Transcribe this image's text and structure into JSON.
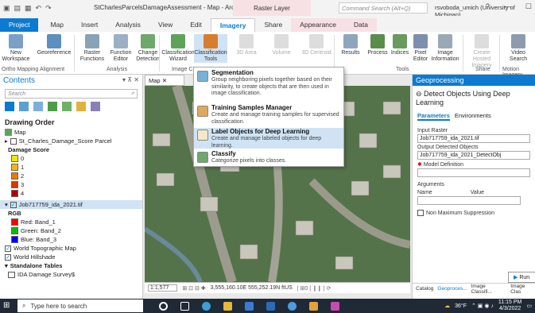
{
  "titlebar": {
    "title": "StCharlesParcelsDamageAssessment - Map - ArcGIS Pro",
    "context": "Raster Layer",
    "command_search": "Command Search (Alt+Q)",
    "user": "rsvoboda_umich (University of Michigan)",
    "help": "?",
    "minimize": "—",
    "maximize": "☐"
  },
  "tabs": [
    "Project",
    "Map",
    "Insert",
    "Analysis",
    "View",
    "Edit",
    "Imagery",
    "Share",
    "Appearance",
    "Data"
  ],
  "ribbon": {
    "buttons": [
      "New Workspace",
      "Georeference",
      "Raster Functions",
      "Function Editor",
      "Change Detection",
      "Classification Wizard",
      "Classification Tools",
      "3D Area",
      "Volume",
      "3D Centroid",
      "Results",
      "Process",
      "Indices",
      "Pixel Editor",
      "Image Information",
      "Create Hosted Imagery",
      "Video Search"
    ],
    "groups": [
      "Ortho Mapping",
      "Alignment",
      "Analysis",
      "Image Cla",
      "Tools",
      "Share",
      "Motion Imagery"
    ]
  },
  "contents": {
    "title": "Contents",
    "search_placeholder": "Search",
    "drawing_order": "Drawing Order",
    "map": "Map",
    "layer_parcel": "St_Charles_Damage_Score Parcel",
    "damage_score": "Damage Score",
    "legend": [
      {
        "label": "0",
        "color": "#f0e800"
      },
      {
        "label": "1",
        "color": "#f5b700"
      },
      {
        "label": "2",
        "color": "#e87a00"
      },
      {
        "label": "3",
        "color": "#d43a00"
      },
      {
        "label": "4",
        "color": "#b00000"
      }
    ],
    "raster_layer": "Job717759_ida_2021.tif",
    "rgb": "RGB",
    "bands": [
      {
        "label": "Red:  Band_1",
        "color": "#ff0000"
      },
      {
        "label": "Green:  Band_2",
        "color": "#00c000"
      },
      {
        "label": "Blue:  Band_3",
        "color": "#0000ff"
      }
    ],
    "basemap_topo": "World Topographic Map",
    "basemap_hillshade": "World Hillshade",
    "standalone": "Standalone Tables",
    "table": "IDA Damage Survey$"
  },
  "map": {
    "tab": "Map",
    "scale": "1:1,577",
    "coords": "3,555,160.10E 555,252.19N ftUS",
    "tools": "| ⊞0 | ❙❙ | ⟳"
  },
  "menu": [
    {
      "title": "Segmentation",
      "desc": "Group neighboring pixels together based on their similarity, to create objects that are then used in image classification."
    },
    {
      "title": "Training Samples Manager",
      "desc": "Create and manage training samples for supervised classification."
    },
    {
      "title": "Label Objects for Deep Learning",
      "desc": "Create and manage labeled objects for deep learning."
    },
    {
      "title": "Classify",
      "desc": "Categorize pixels into classes."
    }
  ],
  "geo": {
    "title": "Geoprocessing",
    "tool": "Detect Objects Using Deep Learning",
    "tab_params": "Parameters",
    "tab_env": "Environments",
    "input_label": "Input Raster",
    "input_value": "Job717759_ida_2021.tif",
    "output_label": "Output Detected Objects",
    "output_value": "Job717759_ida_2021_DetectObj",
    "model_label": "Model Definition",
    "args_label": "Arguments",
    "name_col": "Name",
    "value_col": "Value",
    "nms": "Non Maximum Suppression",
    "run": "Run",
    "bottom_tabs": [
      "Catalog",
      "Geoproces...",
      "Image Classifi...",
      "Image Clas"
    ]
  },
  "taskbar": {
    "search": "Type here to search",
    "weather": "36°F",
    "time": "11:15 PM",
    "date": "4/3/2022"
  }
}
